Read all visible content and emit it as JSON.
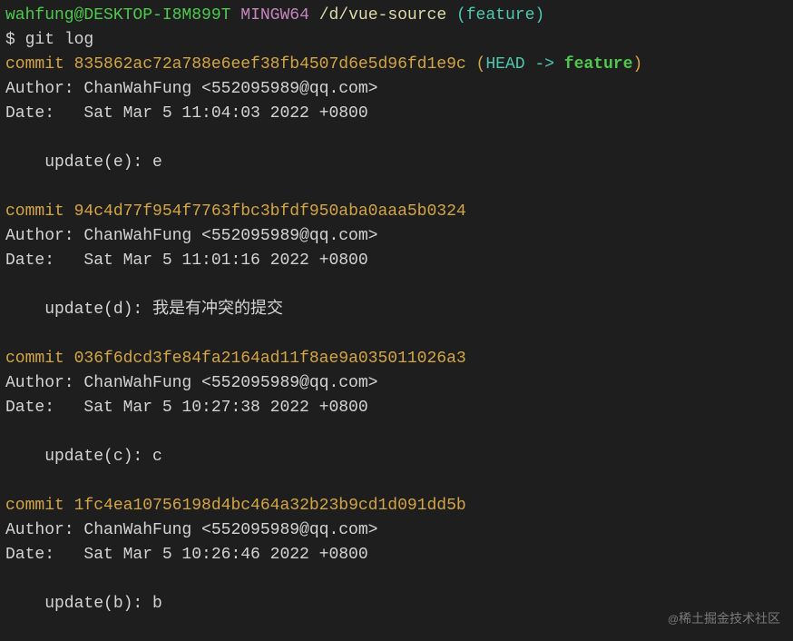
{
  "prompt": {
    "user_host": "wahfung@DESKTOP-I8M899T",
    "mingw": "MINGW64",
    "path": "/d/vue-source",
    "branch": "(feature)",
    "dollar": "$",
    "command": "git log"
  },
  "commits": [
    {
      "hash": "835862ac72a788e6eef38fb4507d6e5d96fd1e9c",
      "ref_open": "(",
      "head": "HEAD ->",
      "branch": "feature",
      "ref_close": ")",
      "author": "Author: ChanWahFung <552095989@qq.com>",
      "date": "Date:   Sat Mar 5 11:04:03 2022 +0800",
      "message": "    update(e): e"
    },
    {
      "hash": "94c4d77f954f7763fbc3bfdf950aba0aaa5b0324",
      "author": "Author: ChanWahFung <552095989@qq.com>",
      "date": "Date:   Sat Mar 5 11:01:16 2022 +0800",
      "message": "    update(d): 我是有冲突的提交"
    },
    {
      "hash": "036f6dcd3fe84fa2164ad11f8ae9a035011026a3",
      "author": "Author: ChanWahFung <552095989@qq.com>",
      "date": "Date:   Sat Mar 5 10:27:38 2022 +0800",
      "message": "    update(c): c"
    },
    {
      "hash": "1fc4ea10756198d4bc464a32b23b9cd1d091dd5b",
      "author": "Author: ChanWahFung <552095989@qq.com>",
      "date": "Date:   Sat Mar 5 10:26:46 2022 +0800",
      "message": "    update(b): b"
    }
  ],
  "commit_word": "commit ",
  "watermark": "稀土掘金技术社区"
}
